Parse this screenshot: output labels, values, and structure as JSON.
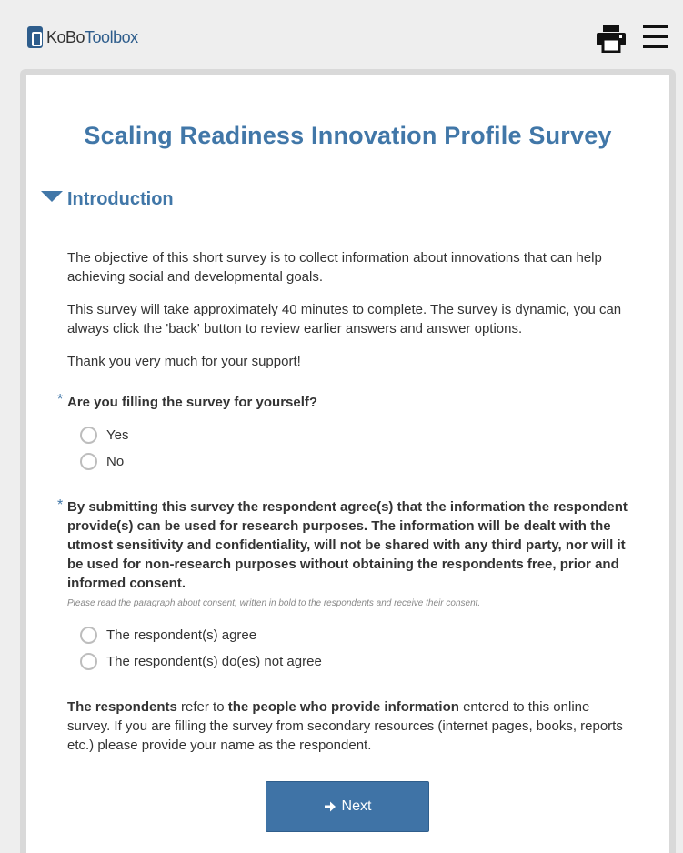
{
  "header": {
    "logo_kobo": "KoBo",
    "logo_toolbox": "Toolbox",
    "print_icon": "printer-icon",
    "menu_icon": "hamburger-menu-icon"
  },
  "survey": {
    "title": "Scaling Readiness Innovation Profile Survey",
    "section": {
      "label": "Introduction",
      "icon": "caret-down-icon"
    },
    "intro": {
      "p1": "The objective of this short survey is to collect information about innovations that can help achieving social and developmental goals.",
      "p2": "This survey will take approximately 40 minutes to complete. The survey is dynamic, you can always click the 'back' button to review earlier answers and answer options.",
      "p3": "Thank you very much for your support!"
    },
    "q1": {
      "required_mark": "*",
      "label": "Are you filling the survey for yourself?",
      "options": [
        "Yes",
        "No"
      ]
    },
    "q2": {
      "required_mark": "*",
      "label": "By submitting this survey the respondent agree(s) that the information the respondent provide(s) can be used for research purposes. The information will be dealt with the utmost sensitivity and confidentiality, will not be shared with any third party, nor will it be used for non-research purposes without obtaining the respondents free, prior and informed consent.",
      "hint": "Please read the paragraph about consent, written in bold to the respondents and receive their consent.",
      "options": [
        "The respondent(s) agree",
        "The respondent(s) do(es) not agree"
      ]
    },
    "note": {
      "bold1": "The respondents",
      "text1": " refer to ",
      "bold2": "the people who provide information",
      "text2": " entered to this online survey. If you are filling the survey from secondary resources (internet pages, books, reports etc.) please provide your name as the respondent."
    },
    "next_label": "Next",
    "next_icon": "arrow-right-icon"
  },
  "colors": {
    "accent": "#4177a8",
    "button": "#3f73a6",
    "background": "#eeeeee"
  }
}
